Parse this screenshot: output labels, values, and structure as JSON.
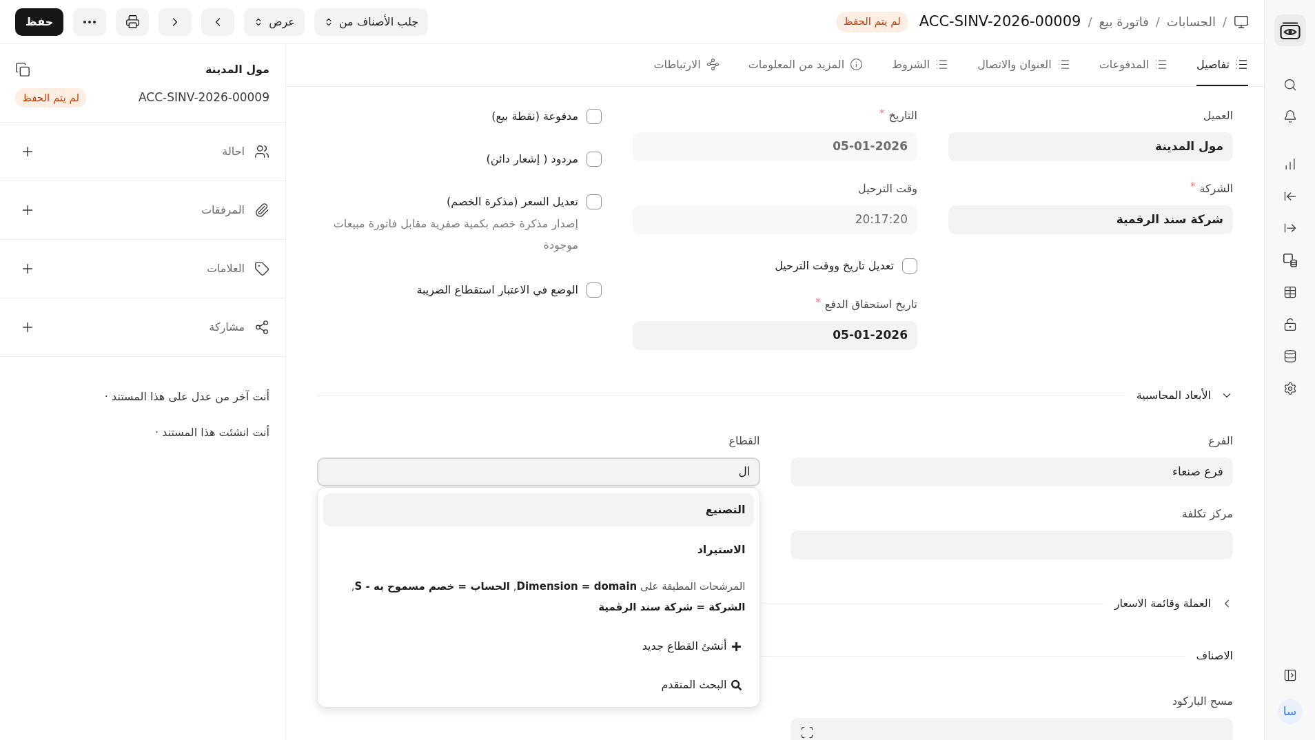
{
  "topbar": {
    "breadcrumbs": [
      {
        "separator": "/",
        "label": "الحسابات"
      },
      {
        "separator": "/",
        "label": "فاتورة بيع"
      }
    ],
    "title": {
      "separator": "/",
      "text": "ACC-SINV-2026-00009"
    },
    "status_badge": "لم يتم الحفظ",
    "actions": [
      {
        "label": "جلب الأصناف من"
      },
      {
        "label": "عرض"
      }
    ],
    "save_button": "حفظ"
  },
  "tabs": [
    {
      "label": "تفاصيل",
      "selected": true
    },
    {
      "label": "المدفوعات",
      "selected": false
    },
    {
      "label": "العنوان والاتصال",
      "selected": false
    },
    {
      "label": "الشروط",
      "selected": false
    },
    {
      "label": "المزيد من المعلومات",
      "selected": false
    },
    {
      "label": "الارتباطات",
      "selected": false
    }
  ],
  "details": {
    "columns": [
      {
        "fields": [
          {
            "kind": "link_field",
            "label": "العميل",
            "value": "مول المدينة",
            "disabled": false
          },
          {
            "kind": "link_field",
            "label": "الشركة",
            "required_mark": "*",
            "value": "شركة سند الرقمية",
            "disabled": false
          }
        ]
      },
      {
        "fields": [
          {
            "kind": "date_field",
            "label": "التاريخ",
            "required_mark": "*",
            "value": "05-01-2026",
            "disabled": true
          },
          {
            "kind": "time_field",
            "label": "وقت الترحيل",
            "value": "20:17:20",
            "disabled": true
          },
          {
            "kind": "checkbox",
            "label": "تعديل تاريخ ووقت الترحيل",
            "checked": false
          },
          {
            "kind": "date_field",
            "label": "تاريخ استحقاق الدفع",
            "required_mark": "*",
            "value": "05-01-2026",
            "disabled": false
          }
        ]
      },
      {
        "fields": [
          {
            "kind": "checkbox",
            "label": "مدفوعة (نقطة بيع)",
            "checked": false
          },
          {
            "kind": "checkbox",
            "label": "مردود ( إشعار دائن)",
            "checked": false
          },
          {
            "kind": "checkbox",
            "label": "تعديل السعر (مذكرة الخصم)",
            "checked": false,
            "description": "إصدار مذكرة خصم بكمية صفرية مقابل فاتورة مبيعات موجودة"
          },
          {
            "kind": "checkbox",
            "label": "الوضع في الاعتبار استقطاع الضريبة",
            "checked": false
          }
        ]
      }
    ]
  },
  "sections": [
    {
      "kind": "collapsible",
      "title": "الأبعاد المحاسبية",
      "expanded": true,
      "columns": [
        {
          "fields": [
            {
              "kind": "text_field",
              "label": "الفرع",
              "value": "فرع صنعاء",
              "disabled": false,
              "focused": false
            },
            {
              "kind": "text_field",
              "label": "مركز تكلفة",
              "disabled": false,
              "focused": false
            }
          ]
        },
        {
          "fields": [
            {
              "kind": "text_field",
              "label": "القطاع",
              "value": "ال",
              "disabled": false,
              "focused": true,
              "dropdown": {
                "options": [
                  {
                    "label": "التصنيع",
                    "selected": true
                  },
                  {
                    "label": "الاستيراد",
                    "selected": false
                  }
                ],
                "filter_note": "المرشحات المطبقة على **Dimension = domain**, **الحساب = خصم مسموح به - S**, **الشركة = شركة سند الرقمية**",
                "actions": [
                  {
                    "label": "أنشئ القطاع جديد"
                  },
                  {
                    "label": "البحث المتقدم"
                  }
                ]
              }
            }
          ]
        }
      ]
    },
    {
      "kind": "collapsible",
      "title": "العملة وقائمة الاسعار",
      "expanded": false
    },
    {
      "kind": "heading",
      "title": "الاصناف",
      "columns": [
        {
          "fields": [
            {
              "kind": "scan_field",
              "label": "مسح الباركود"
            }
          ]
        }
      ]
    }
  ],
  "sidebar": {
    "title": "مول المدينة",
    "doc_name": "ACC-SINV-2026-00009",
    "status_badge": "لم يتم الحفظ",
    "items": [
      {
        "label": "احالة"
      },
      {
        "label": "المرفقات"
      },
      {
        "label": "العلامات"
      },
      {
        "label": "مشاركة"
      }
    ],
    "activity": [
      "أنت آخر من عدل على هذا المستند ·",
      "أنت انشئت هذا المستند ·"
    ]
  },
  "rail": {
    "avatar_initials": "سا"
  }
}
